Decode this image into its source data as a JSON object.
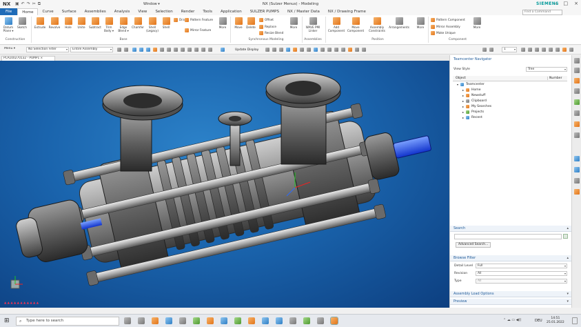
{
  "titlebar": {
    "app": "NX",
    "window_menu": "Window ▾",
    "title": "NX (Sulzer Menus) - Modeling",
    "brand": "SIEMENS"
  },
  "tabs": [
    "File",
    "Home",
    "Curve",
    "Surface",
    "Assemblies",
    "Analysis",
    "View",
    "Selection",
    "Render",
    "Tools",
    "Application",
    "SULZER PUMPS",
    "NX / Master Data",
    "NX / Drawing Frame"
  ],
  "find_command": {
    "placeholder": "Find a Command"
  },
  "ribbon": {
    "construction": {
      "group": "Construction",
      "datum": "Datum Plane ▾",
      "sketch": "Sketch"
    },
    "base": {
      "group": "Base",
      "buttons": [
        "Extrude",
        "Revolve",
        "Hole",
        "Unite",
        "Subtract",
        "Trim Body ▾",
        "Edge Blend ▾",
        "Chamfer",
        "Shell (Legacy)",
        "Shell"
      ],
      "small": [
        "Draft",
        "Pattern Feature",
        "Mirror Feature"
      ]
    },
    "more1": "More",
    "sync": {
      "group": "Synchronous Modeling",
      "buttons": [
        "Move",
        "Delete"
      ],
      "small": [
        "Offset",
        "Replace",
        "Resize Blend"
      ],
      "more": "More"
    },
    "assemblies": {
      "group": "Assemblies",
      "button": "WAVE PMI Linker"
    },
    "position": {
      "group": "Position",
      "buttons": [
        "Add Component",
        "Move Component",
        "Assembly Constraints",
        "Arrangements"
      ],
      "more": "More"
    },
    "component": {
      "group": "Component",
      "small": [
        "Pattern Component",
        "Mirror Assembly",
        "Make Unique"
      ],
      "more": "More"
    }
  },
  "toolbar": {
    "menu": "Menu ▾",
    "filter": "No Selection Filter",
    "scope": "Entire Assembly",
    "update": "Update Display",
    "layer": "1"
  },
  "graphics_tab": "PCA100270132 - PUMP1 ×",
  "viewport_note": "▲ ▲ ▲ ▲ ▲ ▲ ▲ ▲ ▲ ▲ ▲",
  "navigator": {
    "title": "Teamcenter Navigator",
    "view_style_label": "View Style",
    "view_style": "Tree",
    "col_object": "Object",
    "col_number": "Number",
    "tree": [
      "Teamcenter",
      "Home",
      "Newstuff",
      "Clipboard",
      "My Searches",
      "Projects",
      "Recent"
    ],
    "search_header": "Search",
    "advanced_search": "Advanced Search...",
    "browse_filter": "Browse Filter",
    "detail_level_label": "Detail Level",
    "detail_level": "Full",
    "revision_label": "Revision",
    "revision": "All",
    "type_label": "Type",
    "type": "All",
    "assembly_load": "Assembly Load Options",
    "preview": "Preview"
  },
  "taskbar": {
    "search_placeholder": "Type here to search",
    "time": "14:51",
    "date": "25.01.2022",
    "lang": "DEU"
  },
  "colors": {
    "file_tab": "#1e6bb8",
    "viewport": "#1a64ad",
    "accent": "#e2751a"
  }
}
